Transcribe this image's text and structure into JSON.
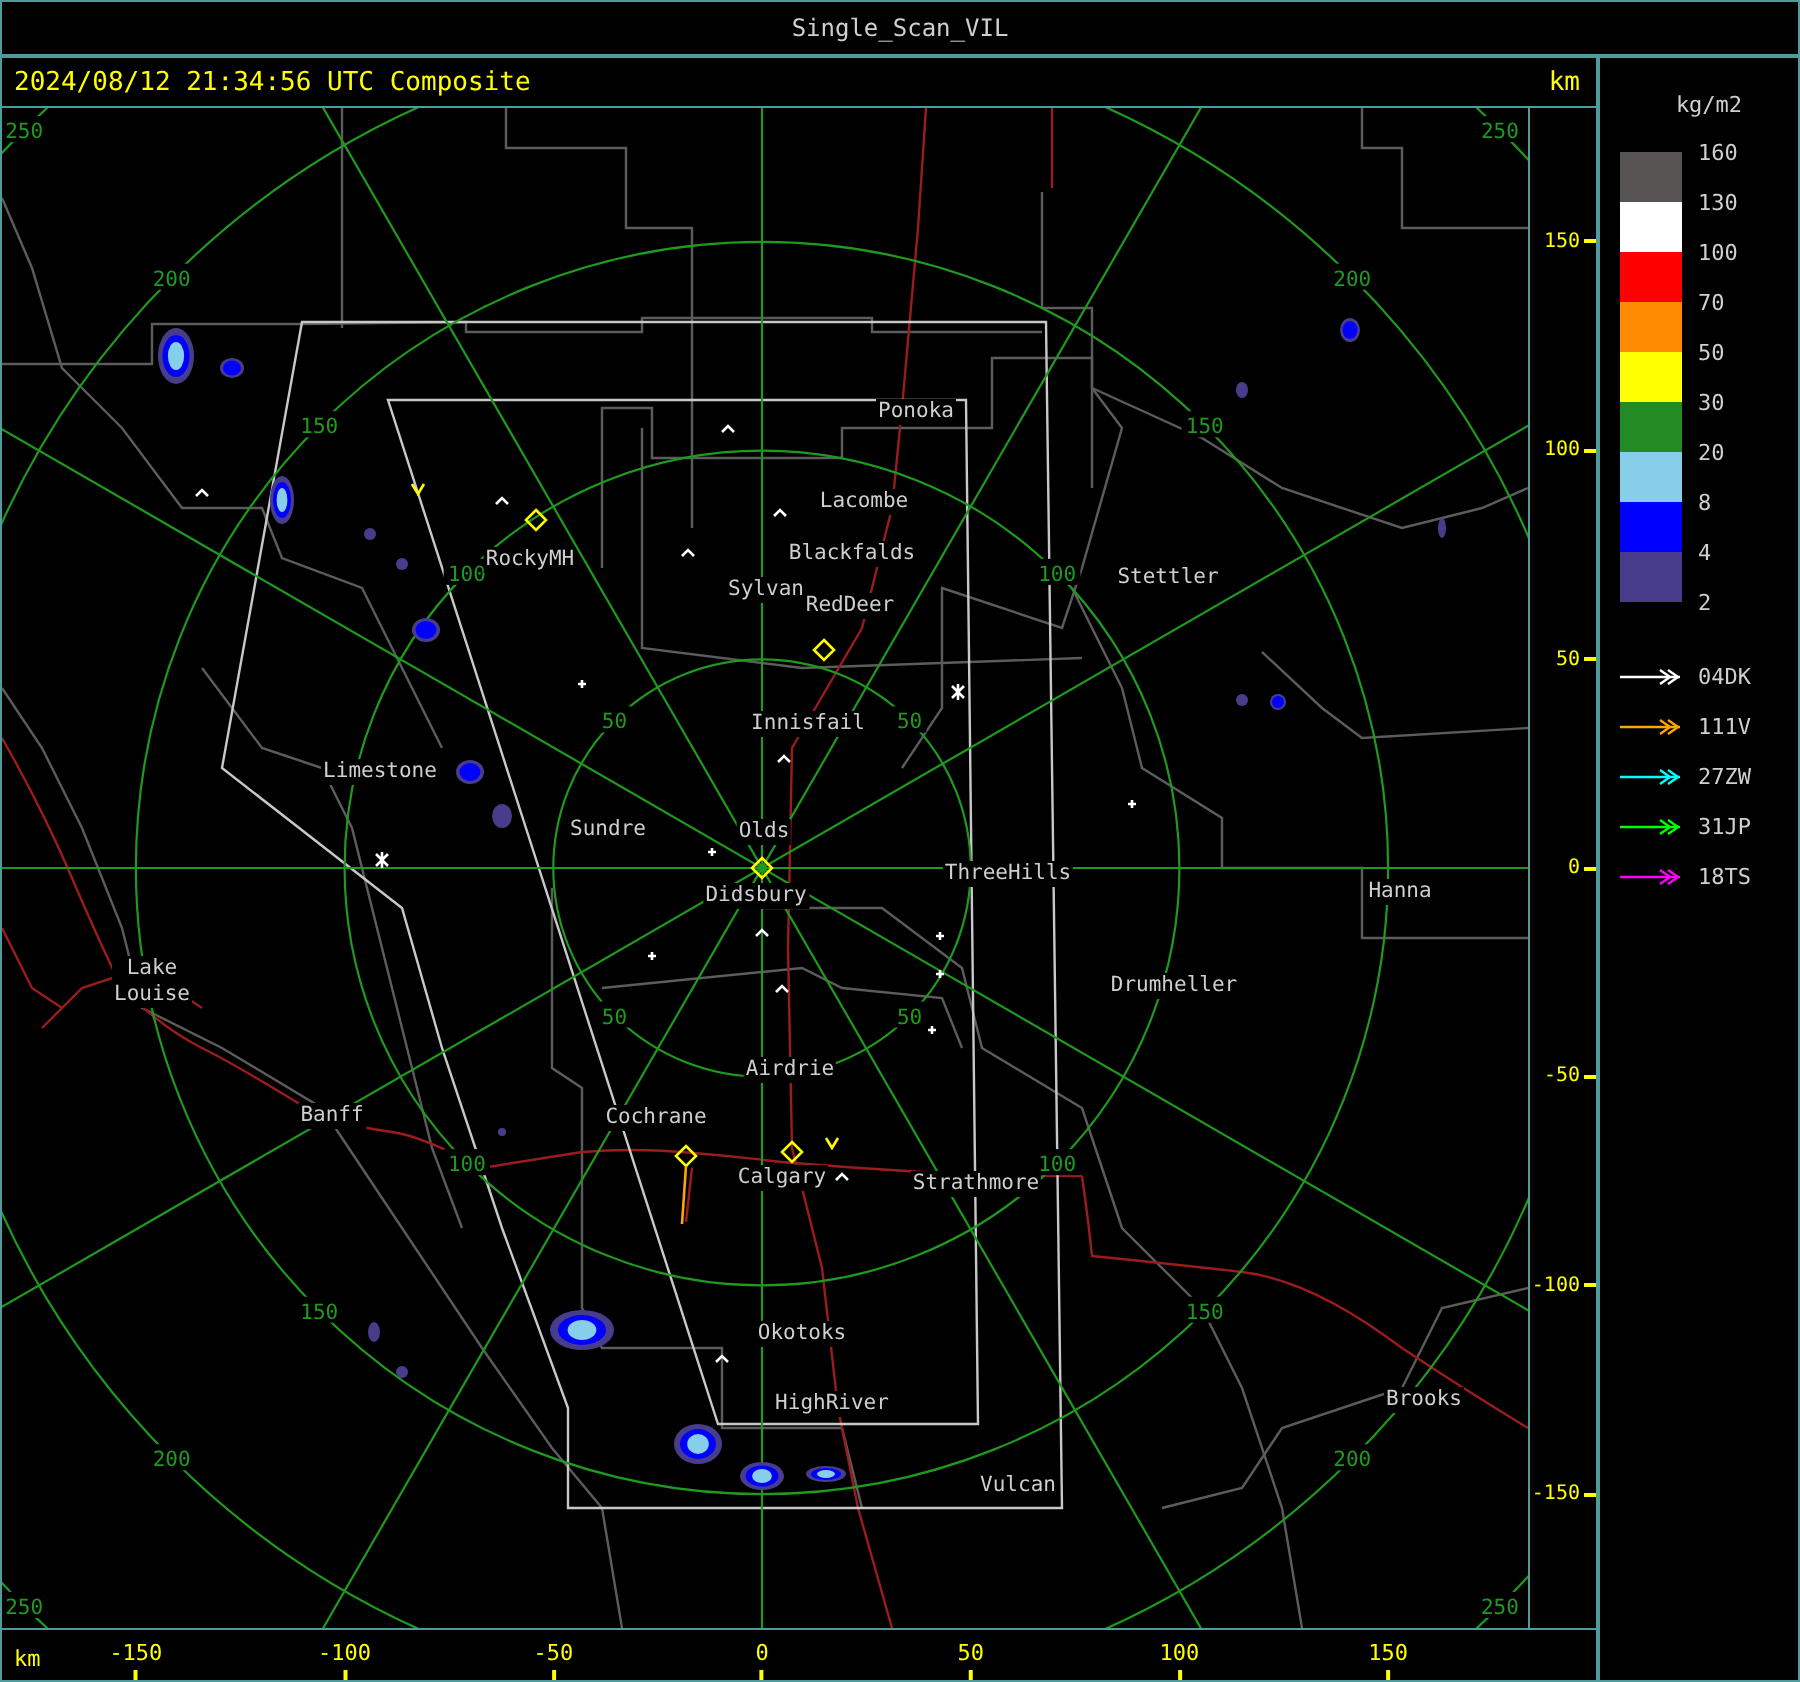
{
  "window": {
    "title": "Single_Scan_VIL"
  },
  "header": {
    "timestamp": "2024/08/12 21:34:56 UTC Composite",
    "unit": "km"
  },
  "map": {
    "range_rings": [
      {
        "labels": [
          "50",
          "50",
          "50",
          "50"
        ]
      },
      {
        "labels": [
          "100",
          "100",
          "100",
          "100"
        ]
      },
      {
        "labels": [
          "150",
          "150",
          "150",
          "150"
        ]
      },
      {
        "labels": [
          "200",
          "200",
          "200",
          "200"
        ]
      },
      {
        "labels": [
          "250",
          "250",
          "250",
          "250"
        ]
      }
    ],
    "places": [
      {
        "name": "Ponoka"
      },
      {
        "name": "Lacombe"
      },
      {
        "name": "Blackfalds"
      },
      {
        "name": "Sylvan"
      },
      {
        "name": "RedDeer"
      },
      {
        "name": "RockyMH"
      },
      {
        "name": "Stettler"
      },
      {
        "name": "Innisfail"
      },
      {
        "name": "Limestone"
      },
      {
        "name": "Sundre"
      },
      {
        "name": "Olds"
      },
      {
        "name": "Didsbury"
      },
      {
        "name": "ThreeHills"
      },
      {
        "name": "Hanna"
      },
      {
        "name": "Drumheller"
      },
      {
        "name": "Lake Louise"
      },
      {
        "name": "Banff"
      },
      {
        "name": "Cochrane"
      },
      {
        "name": "Airdrie"
      },
      {
        "name": "Calgary"
      },
      {
        "name": "Strathmore"
      },
      {
        "name": "Okotoks"
      },
      {
        "name": "HighRiver"
      },
      {
        "name": "Vulcan"
      },
      {
        "name": "Brooks"
      }
    ]
  },
  "y_axis": {
    "ticks": [
      "150",
      "100",
      "50",
      "0",
      "-50",
      "-100",
      "-150"
    ]
  },
  "x_axis": {
    "unit": "km",
    "ticks": [
      "-150",
      "-100",
      "-50",
      "0",
      "50",
      "100",
      "150"
    ]
  },
  "legend": {
    "unit": "kg/m2",
    "bands": [
      {
        "color": "#575353"
      },
      {
        "color": "#ffffff"
      },
      {
        "color": "#ff0000"
      },
      {
        "color": "#ff8c00"
      },
      {
        "color": "#ffff00"
      },
      {
        "color": "#228b22"
      },
      {
        "color": "#87ceeb"
      },
      {
        "color": "#0000ff"
      },
      {
        "color": "#483d8b"
      }
    ],
    "band_labels": [
      "160",
      "130",
      "100",
      "70",
      "50",
      "30",
      "20",
      "8",
      "4",
      "2"
    ],
    "tracks": [
      {
        "label": "04DK",
        "color": "#ffffff"
      },
      {
        "label": "111V",
        "color": "#ffa500"
      },
      {
        "label": "27ZW",
        "color": "#00ffff"
      },
      {
        "label": "31JP",
        "color": "#00ff00"
      },
      {
        "label": "18TS",
        "color": "#ff00ff"
      }
    ]
  }
}
